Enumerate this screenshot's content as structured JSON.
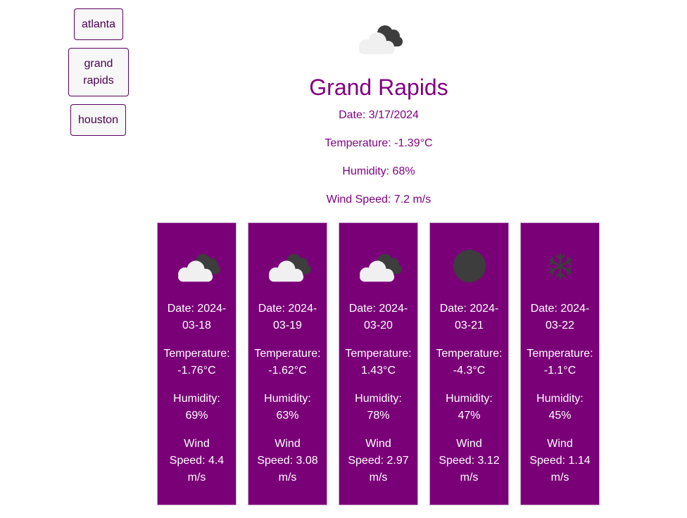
{
  "cities": [
    {
      "label": "atlanta"
    },
    {
      "label": "grand rapids",
      "lines": [
        "grand",
        "rapids"
      ]
    },
    {
      "label": "houston"
    }
  ],
  "current": {
    "city": "Grand Rapids",
    "date": "Date: 3/17/2024",
    "temperature": "Temperature: -1.39°C",
    "humidity": "Humidity: 68%",
    "wind": "Wind Speed: 7.2 m/s",
    "icon": "cloudy-icon"
  },
  "forecast": [
    {
      "date1": "Date: 2024-",
      "date2": "03-18",
      "temp1": "Temperature:",
      "temp2": "-1.76°C",
      "hum1": "Humidity:",
      "hum2": "69%",
      "wind1": "Wind",
      "wind2": "Speed: 4.4",
      "wind3": "m/s",
      "icon": "cloudy-icon"
    },
    {
      "date1": "Date: 2024-",
      "date2": "03-19",
      "temp1": "Temperature:",
      "temp2": "-1.62°C",
      "hum1": "Humidity:",
      "hum2": "63%",
      "wind1": "Wind",
      "wind2": "Speed: 3.08",
      "wind3": "m/s",
      "icon": "cloudy-icon"
    },
    {
      "date1": "Date: 2024-",
      "date2": "03-20",
      "temp1": "Temperature:",
      "temp2": "1.43°C",
      "hum1": "Humidity:",
      "hum2": "78%",
      "wind1": "Wind",
      "wind2": "Speed: 2.97",
      "wind3": "m/s",
      "icon": "cloudy-icon"
    },
    {
      "date1": "Date: 2024-",
      "date2": "03-21",
      "temp1": "Temperature:",
      "temp2": "-4.3°C",
      "hum1": "Humidity:",
      "hum2": "47%",
      "wind1": "Wind",
      "wind2": "Speed: 3.12",
      "wind3": "m/s",
      "icon": "overcast-icon"
    },
    {
      "date1": "Date: 2024-",
      "date2": "03-22",
      "temp1": "Temperature:",
      "temp2": "-1.1°C",
      "hum1": "Humidity:",
      "hum2": "45%",
      "wind1": "Wind",
      "wind2": "Speed: 1.14",
      "wind3": "m/s",
      "icon": "snowflake-icon"
    }
  ],
  "colors": {
    "accent": "#800080",
    "card_bg": "#7a0078",
    "cloud_light": "#f0f0f0",
    "cloud_dark": "#3d3d3d"
  }
}
